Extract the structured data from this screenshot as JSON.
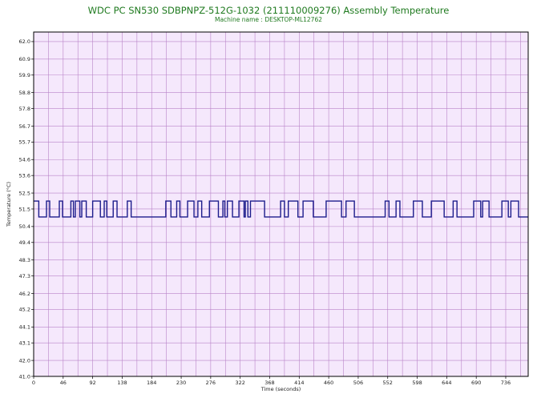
{
  "chart_data": {
    "type": "line",
    "title": "WDC PC SN530 SDBPNPZ-512G-1032 (211110009276) Assembly Temperature",
    "subtitle": "Machine name : DESKTOP-ML12762",
    "xlabel": "Time (seconds)",
    "ylabel": "Temperature (°C)",
    "xlim": [
      0,
      771
    ],
    "ylim": [
      41.0,
      62.6
    ],
    "x_ticks": [
      "0",
      "46",
      "92",
      "138",
      "184",
      "230",
      "276",
      "322",
      "368",
      "414",
      "460",
      "506",
      "552",
      "598",
      "644",
      "690",
      "736"
    ],
    "y_ticks": [
      "62.0",
      "60.9",
      "59.9",
      "58.8",
      "57.8",
      "56.7",
      "55.7",
      "54.6",
      "53.6",
      "52.5",
      "51.5",
      "50.4",
      "49.4",
      "48.3",
      "47.3",
      "46.2",
      "45.2",
      "44.1",
      "43.1",
      "42.0",
      "41.0"
    ],
    "grid": true,
    "colors": {
      "plot_bg": "#f5e8fc",
      "grid": "#b983c8",
      "line": "#1c1c8c",
      "title": "#1f7a1f"
    },
    "series": [
      {
        "points": [
          [
            0,
            52.0
          ],
          [
            8,
            52.0
          ],
          [
            8,
            51.0
          ],
          [
            20,
            51.0
          ],
          [
            20,
            52.0
          ],
          [
            25,
            52.0
          ],
          [
            25,
            51.0
          ],
          [
            40,
            51.0
          ],
          [
            40,
            52.0
          ],
          [
            45,
            52.0
          ],
          [
            45,
            51.0
          ],
          [
            58,
            51.0
          ],
          [
            58,
            52.0
          ],
          [
            62,
            52.0
          ],
          [
            62,
            51.0
          ],
          [
            65,
            51.0
          ],
          [
            65,
            52.0
          ],
          [
            72,
            52.0
          ],
          [
            72,
            51.0
          ],
          [
            75,
            51.0
          ],
          [
            75,
            52.0
          ],
          [
            82,
            52.0
          ],
          [
            82,
            51.0
          ],
          [
            92,
            51.0
          ],
          [
            92,
            52.0
          ],
          [
            104,
            52.0
          ],
          [
            104,
            51.0
          ],
          [
            110,
            51.0
          ],
          [
            110,
            52.0
          ],
          [
            114,
            52.0
          ],
          [
            114,
            51.0
          ],
          [
            124,
            51.0
          ],
          [
            124,
            52.0
          ],
          [
            130,
            52.0
          ],
          [
            130,
            51.0
          ],
          [
            146,
            51.0
          ],
          [
            146,
            52.0
          ],
          [
            152,
            52.0
          ],
          [
            152,
            51.0
          ],
          [
            206,
            51.0
          ],
          [
            206,
            52.0
          ],
          [
            214,
            52.0
          ],
          [
            214,
            51.0
          ],
          [
            223,
            51.0
          ],
          [
            223,
            52.0
          ],
          [
            228,
            52.0
          ],
          [
            228,
            51.0
          ],
          [
            240,
            51.0
          ],
          [
            240,
            52.0
          ],
          [
            250,
            52.0
          ],
          [
            250,
            51.0
          ],
          [
            256,
            51.0
          ],
          [
            256,
            52.0
          ],
          [
            262,
            52.0
          ],
          [
            262,
            51.0
          ],
          [
            274,
            51.0
          ],
          [
            274,
            52.0
          ],
          [
            288,
            52.0
          ],
          [
            288,
            51.0
          ],
          [
            295,
            51.0
          ],
          [
            295,
            52.0
          ],
          [
            298,
            52.0
          ],
          [
            298,
            51.0
          ],
          [
            302,
            51.0
          ],
          [
            302,
            52.0
          ],
          [
            310,
            52.0
          ],
          [
            310,
            51.0
          ],
          [
            320,
            51.0
          ],
          [
            320,
            52.0
          ],
          [
            328,
            52.0
          ],
          [
            328,
            51.0
          ],
          [
            330,
            51.0
          ],
          [
            330,
            52.0
          ],
          [
            334,
            52.0
          ],
          [
            334,
            51.0
          ],
          [
            338,
            51.0
          ],
          [
            338,
            52.0
          ],
          [
            360,
            52.0
          ],
          [
            360,
            51.0
          ],
          [
            385,
            51.0
          ],
          [
            385,
            52.0
          ],
          [
            391,
            52.0
          ],
          [
            391,
            51.0
          ],
          [
            397,
            51.0
          ],
          [
            397,
            52.0
          ],
          [
            412,
            52.0
          ],
          [
            412,
            51.0
          ],
          [
            420,
            51.0
          ],
          [
            420,
            52.0
          ],
          [
            436,
            52.0
          ],
          [
            436,
            51.0
          ],
          [
            456,
            51.0
          ],
          [
            456,
            52.0
          ],
          [
            480,
            52.0
          ],
          [
            480,
            51.0
          ],
          [
            487,
            51.0
          ],
          [
            487,
            52.0
          ],
          [
            500,
            52.0
          ],
          [
            500,
            51.0
          ],
          [
            548,
            51.0
          ],
          [
            548,
            52.0
          ],
          [
            554,
            52.0
          ],
          [
            554,
            51.0
          ],
          [
            565,
            51.0
          ],
          [
            565,
            52.0
          ],
          [
            571,
            52.0
          ],
          [
            571,
            51.0
          ],
          [
            592,
            51.0
          ],
          [
            592,
            52.0
          ],
          [
            606,
            52.0
          ],
          [
            606,
            51.0
          ],
          [
            620,
            51.0
          ],
          [
            620,
            52.0
          ],
          [
            640,
            52.0
          ],
          [
            640,
            51.0
          ],
          [
            654,
            51.0
          ],
          [
            654,
            52.0
          ],
          [
            660,
            52.0
          ],
          [
            660,
            51.0
          ],
          [
            686,
            51.0
          ],
          [
            686,
            52.0
          ],
          [
            697,
            52.0
          ],
          [
            697,
            51.0
          ],
          [
            700,
            51.0
          ],
          [
            700,
            52.0
          ],
          [
            710,
            52.0
          ],
          [
            710,
            51.0
          ],
          [
            730,
            51.0
          ],
          [
            730,
            52.0
          ],
          [
            740,
            52.0
          ],
          [
            740,
            51.0
          ],
          [
            744,
            51.0
          ],
          [
            744,
            52.0
          ],
          [
            756,
            52.0
          ],
          [
            756,
            51.0
          ],
          [
            771,
            51.0
          ]
        ]
      }
    ]
  }
}
